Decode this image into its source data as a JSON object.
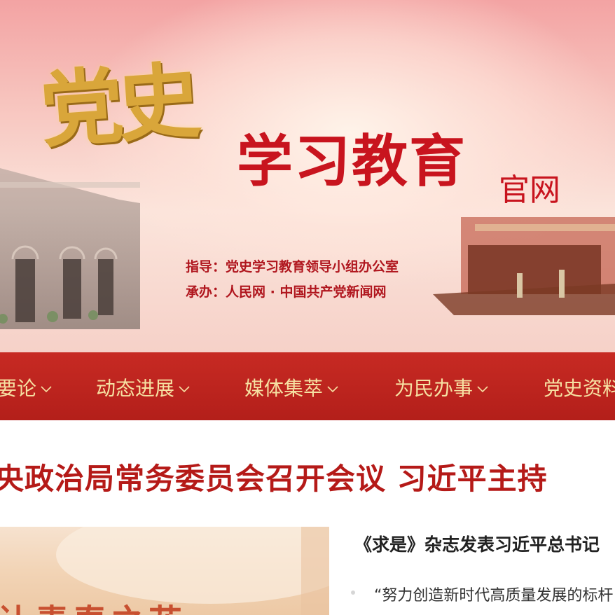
{
  "banner": {
    "calligraphy": "党史",
    "title": "学习教育",
    "subtitle": "官网",
    "guide_line": "指导：党史学习教育领导小组办公室",
    "host_line": "承办：人民网 · 中国共产党新闻网"
  },
  "nav": {
    "items": [
      {
        "label": "要论"
      },
      {
        "label": "动态进展"
      },
      {
        "label": "媒体集萃"
      },
      {
        "label": "为民办事"
      },
      {
        "label": "党史资料"
      }
    ]
  },
  "headline": "央政治局常务委员会召开会议 习近平主持",
  "feature": {
    "photo_caption": "让青春之花",
    "article_title": "《求是》杂志发表习近平总书记",
    "article_quote": "“努力创造新时代高质量发展的标杆"
  },
  "colors": {
    "nav_bg": "#b9221c",
    "nav_text": "#f6e0a2",
    "headline": "#b51a18",
    "title_red": "#c8141e",
    "calligraphy_gold": "#d9a63a"
  }
}
